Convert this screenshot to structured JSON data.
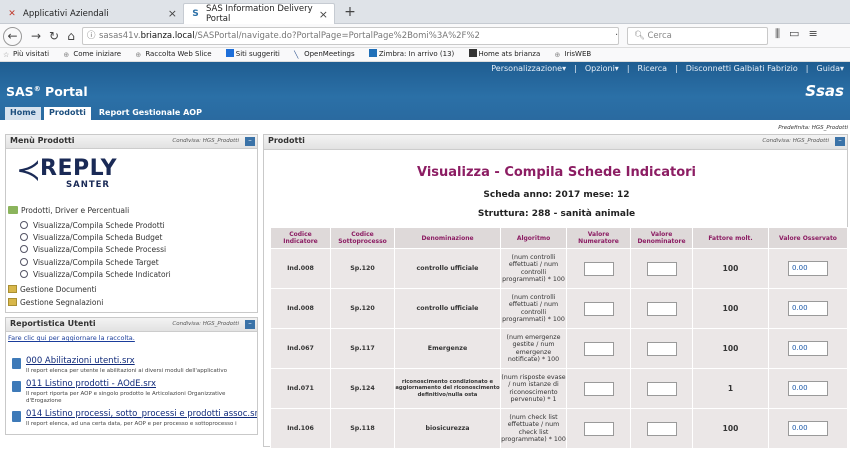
{
  "browser": {
    "tabs": [
      {
        "title": "Applicativi Aziendali",
        "icon": "app-icon",
        "active": false
      },
      {
        "title": "SAS Information Delivery Portal",
        "icon": "sas-icon",
        "active": true
      }
    ],
    "url_prefix": "sasas41v.",
    "url_domain": "brianza.local",
    "url_path": "/SASPortal/navigate.do?PortalPage=PortalPage%2Bomi%3A%2F%2",
    "url_tools": "··· ♡ ☆",
    "search_placeholder": "Cerca",
    "bookmarks": [
      "Più visitati",
      "Come iniziare",
      "Raccolta Web Slice",
      "Siti suggeriti",
      "OpenMeetings",
      "Zimbra: In arrivo (13)",
      "Home ats brianza",
      "IrisWEB"
    ]
  },
  "header": {
    "links": [
      "Personalizzazione▾",
      "|",
      "Opzioni▾",
      "|",
      "Ricerca",
      "|",
      "Disconnetti Galbiati Fabrizio",
      "|",
      "Guida▾"
    ],
    "portal_name": "SAS",
    "portal_reg": "®",
    "portal_suffix": " Portal",
    "logo": "Ssas",
    "nav_tabs": [
      "Home",
      "Prodotti",
      "Report Gestionale AOP"
    ]
  },
  "predefinita": "Predefinita: HGS_Prodotti",
  "menu_prodotti": {
    "title": "Menù Prodotti",
    "shared": "Condivisa: HGS_Prodotti",
    "logo_word": "REPLY",
    "logo_sub": "SANTER",
    "folder_label": "Prodotti, Driver e Percentuali",
    "items": [
      "Visualizza/Compila Schede Prodotti",
      "Visualizza/Compila Scheda Budget",
      "Visualizza/Compila Schede Processi",
      "Visualizza/Compila Schede Target",
      "Visualizza/Compila Schede Indicatori"
    ],
    "gestione": [
      "Gestione Documenti",
      "Gestione Segnalazioni"
    ]
  },
  "reportistica": {
    "title": "Reportistica Utenti",
    "shared": "Condivisa: HGS_Prodotti",
    "refresh_link": "Fare clic qui per aggiornare la raccolta.",
    "reports": [
      {
        "name": "000 Abilitazioni utenti.srx",
        "desc": "Il report elenca per utente le abilitazioni ai diversi moduli dell'applicativo"
      },
      {
        "name": "011 Listino prodotti - AOdE.srx",
        "desc": "Il report riporta per AOP e singolo prodotto le Articolazioni Organizzative d'Erogazione"
      },
      {
        "name": "014 Listino processi, sotto_processi e prodotti assoc.srx",
        "desc": "Il report elenca, ad una certa data, per AOP e per processo e sottoprocesso i"
      }
    ]
  },
  "prodotti_panel": {
    "title": "Prodotti",
    "shared": "Condivisa: HGS_Prodotti",
    "heading": "Visualizza - Compila Schede Indicatori",
    "scheda": "Scheda anno: 2017 mese: 12",
    "struttura": "Struttura: 288 - sanità animale",
    "columns": [
      "Codice Indicatore",
      "Codice Sottoprocesso",
      "Denominazione",
      "Algoritmo",
      "Valore Numeratore",
      "Valore Denominatore",
      "Fattore molt.",
      "Valore Osservato"
    ],
    "rows": [
      {
        "codice": "Ind.008",
        "sottoprocesso": "Sp.120",
        "denominazione": "controllo ufficiale",
        "algoritmo": "(num controlli effettuati / num controlli programmati) * 100",
        "fattore": "100",
        "osservato": "0.00"
      },
      {
        "codice": "Ind.008",
        "sottoprocesso": "Sp.120",
        "denominazione": "controllo ufficiale",
        "algoritmo": "(num controlli effettuati / num controlli programmati) * 100",
        "fattore": "100",
        "osservato": "0.00"
      },
      {
        "codice": "Ind.067",
        "sottoprocesso": "Sp.117",
        "denominazione": "Emergenze",
        "algoritmo": "(num emergenze gestite / num emergenze notificate) * 100",
        "fattore": "100",
        "osservato": "0.00"
      },
      {
        "codice": "Ind.071",
        "sottoprocesso": "Sp.124",
        "denominazione": "riconoscimento condizionato e aggiornamento del riconoscimento definitivo/nulla osta",
        "algoritmo": "(num risposte evase / num istanze di riconoscimento pervenute) * 1",
        "fattore": "1",
        "osservato": "0.00"
      },
      {
        "codice": "Ind.106",
        "sottoprocesso": "Sp.118",
        "denominazione": "biosicurezza",
        "algoritmo": "(num check list effettuate / num check list programmate) * 100",
        "fattore": "100",
        "osservato": "0.00"
      }
    ]
  }
}
